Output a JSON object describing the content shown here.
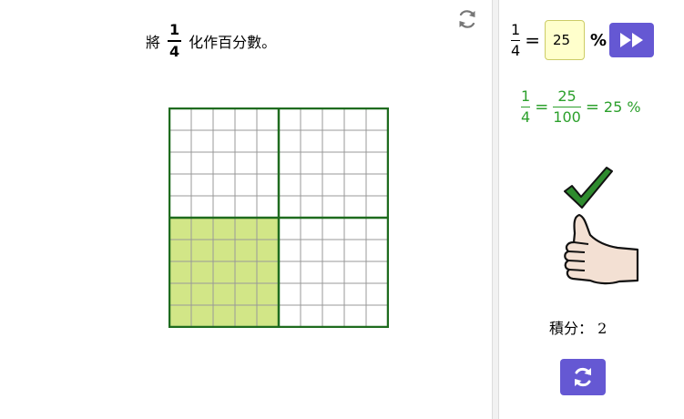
{
  "question": {
    "prefix": "將",
    "numerator": "1",
    "denominator": "4",
    "suffix": "化作百分數。"
  },
  "grid": {
    "rows": 10,
    "cols": 10,
    "shaded_fraction": 0.25,
    "shade_color": "#d2e687",
    "line_color": "#1e6b1e"
  },
  "answer": {
    "numerator": "1",
    "denominator": "4",
    "equals": "=",
    "value": "25",
    "percent": "%"
  },
  "solution": {
    "numerator": "1",
    "denominator": "4",
    "eq1": "=",
    "numerator2": "25",
    "denominator2": "100",
    "eq2": "=",
    "result": "25 %"
  },
  "feedback": {
    "icon": "check-icon",
    "image": "thumbs-up-icon"
  },
  "score": {
    "label": "積分： 2"
  },
  "colors": {
    "accent": "#6558d3",
    "success": "#2ca02c",
    "input_bg": "#ffffcc"
  }
}
